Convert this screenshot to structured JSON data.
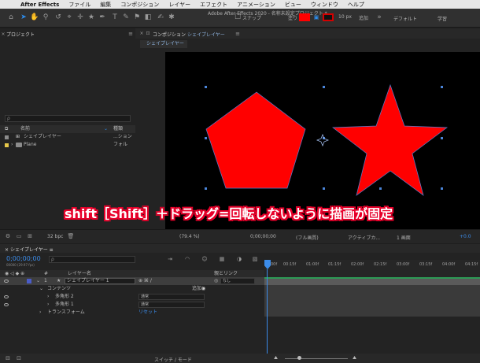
{
  "menubar": {
    "app": "After Effects",
    "items": [
      "ファイル",
      "編集",
      "コンポジション",
      "レイヤー",
      "エフェクト",
      "アニメーション",
      "ビュー",
      "ウィンドウ",
      "ヘルプ"
    ]
  },
  "toolbar": {
    "window_title": "Adobe After Effects 2020 - 名称未設定プロジェクト *",
    "snap_label": "スナップ",
    "fill_label": "塗り",
    "stroke_width": "10 px",
    "add_label": "追加",
    "workspaces": [
      "デフォルト",
      "学習"
    ],
    "fill_color": "#ff0000",
    "stroke_color": "#d40000"
  },
  "project": {
    "tab": "プロジェクト",
    "search_placeholder": "ρ",
    "col_name": "名前",
    "col_type": "種類",
    "items": [
      {
        "name": "シェイプレイヤー",
        "type": "...ション",
        "color": "#8c8c8c"
      },
      {
        "name": "Plane",
        "type": "フォル",
        "color": "#e6c84a"
      }
    ]
  },
  "composition": {
    "tab": "コンポジション",
    "comp_name": "シェイプレイヤー",
    "sub_tab": "シェイプレイヤー",
    "shape_fill": "#ff0000"
  },
  "caption": {
    "text": "shift［Shift］＋ドラッグ=回転しないように描画が固定"
  },
  "comp_footer": {
    "bpc": "32 bpc",
    "zoom": "(79.4 %)",
    "timecode": "0;00;00;00",
    "resolution": "(フル画質)",
    "camera": "アクティブカ...",
    "views": "1 画面",
    "offset": "+0.0"
  },
  "timeline": {
    "tab": "シェイプレイヤー",
    "timecode": "0;00;00;00",
    "fps": "00000 (29.97 fps)",
    "search_placeholder": "ρ",
    "col_num": "#",
    "col_layer": "レイヤー名",
    "col_parent": "親とリンク",
    "layer": {
      "num": "1",
      "name": "シェイプレイヤー 1",
      "parent": "なし"
    },
    "contents": "コンテンツ",
    "add": "追加：",
    "sub_items": [
      {
        "name": "多角形 2",
        "mode": "通常"
      },
      {
        "name": "多角形 1",
        "mode": "通常"
      }
    ],
    "transform": "トランスフォーム",
    "reset": "リセット",
    "ticks": [
      "00f",
      "00:15f",
      "01:00f",
      "01:15f",
      "02:00f",
      "02:15f",
      "03:00f",
      "03:15f",
      "04:00f",
      "04:15f"
    ],
    "switch_mode": "スイッチ / モード"
  }
}
